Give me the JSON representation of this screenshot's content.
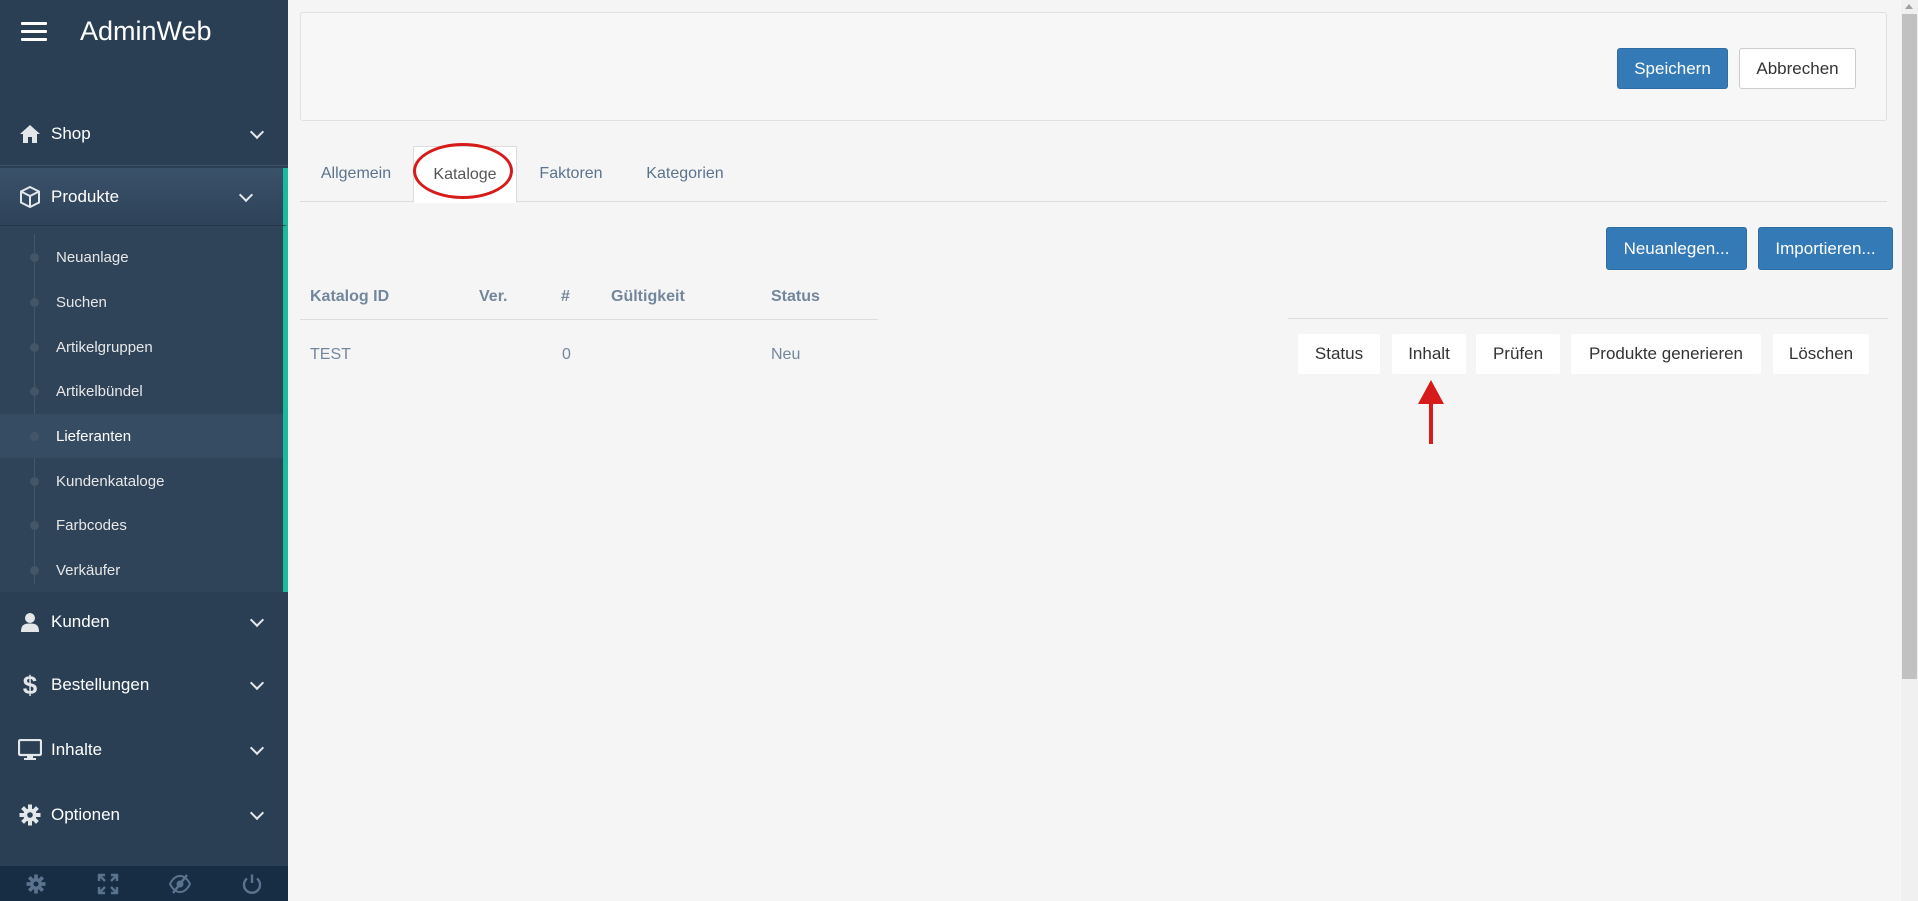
{
  "app": {
    "title": "AdminWeb"
  },
  "sidebar": {
    "shop": "Shop",
    "produkte": "Produkte",
    "sub_items": [
      "Neuanlage",
      "Suchen",
      "Artikelgruppen",
      "Artikelbündel",
      "Lieferanten",
      "Kundenkataloge",
      "Farbcodes",
      "Verkäufer"
    ],
    "active_sub_item": "Lieferanten",
    "kunden": "Kunden",
    "bestellungen": "Bestellungen",
    "inhalte": "Inhalte",
    "optionen": "Optionen",
    "footer_icons": [
      "gear-icon",
      "fullscreen-icon",
      "eye-slash-icon",
      "power-icon"
    ]
  },
  "toolbar": {
    "save_label": "Speichern",
    "cancel_label": "Abbrechen"
  },
  "tabs": [
    {
      "label": "Allgemein"
    },
    {
      "label": "Kataloge",
      "active": true
    },
    {
      "label": "Faktoren"
    },
    {
      "label": "Kategorien"
    }
  ],
  "catalog_actions": {
    "new_label": "Neuanlegen...",
    "import_label": "Importieren..."
  },
  "table": {
    "headers": [
      "Katalog ID",
      "Ver.",
      "#",
      "Gültigkeit",
      "Status"
    ],
    "rows": [
      {
        "id": "TEST",
        "version": "",
        "count": "0",
        "validity": "",
        "status": "Neu"
      }
    ]
  },
  "row_actions": [
    "Status",
    "Inhalt",
    "Prüfen",
    "Produkte generieren",
    "Löschen"
  ],
  "colors": {
    "sidebar_bg": "#2a3f54",
    "accent_green": "#1abb9c",
    "primary_blue": "#337ab7",
    "annotation_red": "#d71a1a"
  }
}
